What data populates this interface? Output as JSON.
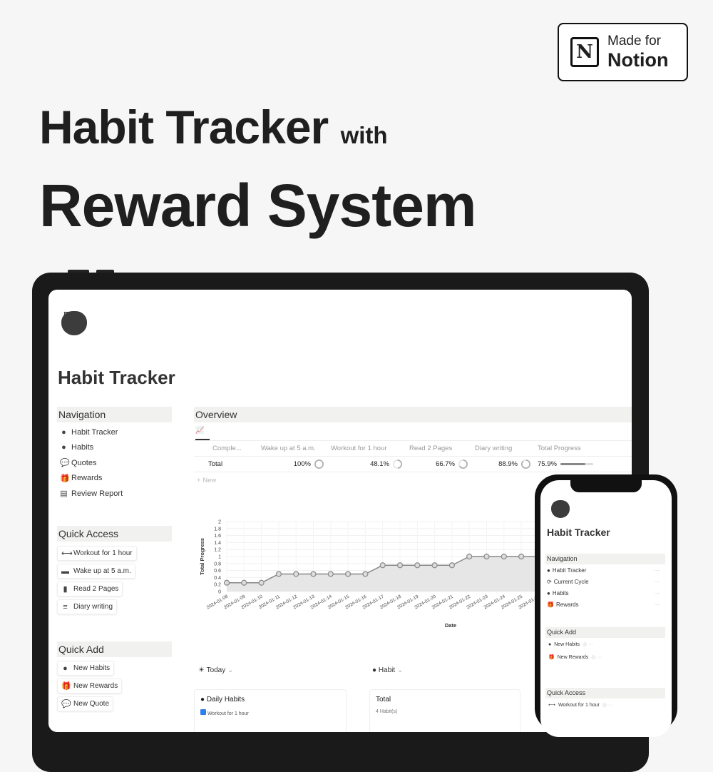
{
  "badge": {
    "line1": "Made for",
    "line2": "Notion",
    "logo": "N"
  },
  "headline": {
    "line1": "Habit Tracker",
    "with": "with",
    "line2": "Reward System"
  },
  "page": {
    "icon": "apple-icon",
    "title": "Habit Tracker"
  },
  "navigation": {
    "heading": "Navigation",
    "items": [
      {
        "label": "Habit Tracker",
        "icon": "apple-icon"
      },
      {
        "label": "Habits",
        "icon": "apple-icon"
      },
      {
        "label": "Quotes",
        "icon": "speech-bubble-icon"
      },
      {
        "label": "Rewards",
        "icon": "gift-icon"
      },
      {
        "label": "Review Report",
        "icon": "report-icon"
      }
    ]
  },
  "quick_access": {
    "heading": "Quick Access",
    "items": [
      {
        "label": "Workout for 1 hour",
        "icon": "dumbbell-icon"
      },
      {
        "label": "Wake up at 5 a.m.",
        "icon": "bed-icon"
      },
      {
        "label": "Read 2 Pages",
        "icon": "book-icon"
      },
      {
        "label": "Diary writing",
        "icon": "pen-icon"
      }
    ]
  },
  "quick_add": {
    "heading": "Quick Add",
    "items": [
      {
        "label": "New Habits",
        "icon": "apple-icon"
      },
      {
        "label": "New Rewards",
        "icon": "gift-icon"
      },
      {
        "label": "New Quote",
        "icon": "speech-bubble-icon"
      }
    ]
  },
  "overview": {
    "heading": "Overview",
    "columns": [
      "Comple...",
      "Wake up at 5 a.m.",
      "Workout for 1 hour",
      "Read 2 Pages",
      "Diary writing",
      "Total Progress"
    ],
    "row": {
      "label": "Total",
      "values": [
        "100%",
        "48.1%",
        "66.7%",
        "88.9%",
        "75.9%"
      ],
      "fractions": [
        1,
        0.481,
        0.667,
        0.889,
        0.759
      ]
    },
    "new_label": "New"
  },
  "chart_data": {
    "type": "area",
    "xlabel": "Date",
    "ylabel": "Total Progress",
    "ylim": [
      0,
      2
    ],
    "yticks": [
      "0",
      "0.2",
      "0.4",
      "0.6",
      "0.8",
      "1",
      "1.2",
      "1.4",
      "1.6",
      "1.8",
      "2"
    ],
    "x": [
      "2024-01-08",
      "2024-01-09",
      "2024-01-10",
      "2024-01-11",
      "2024-01-12",
      "2024-01-13",
      "2024-01-14",
      "2024-01-15",
      "2024-01-16",
      "2024-01-17",
      "2024-01-18",
      "2024-01-19",
      "2024-01-20",
      "2024-01-21",
      "2024-01-22",
      "2024-01-23",
      "2024-01-24",
      "2024-01-25",
      "2024-01-26"
    ],
    "values": [
      0.25,
      0.25,
      0.25,
      0.5,
      0.5,
      0.5,
      0.5,
      0.5,
      0.5,
      0.75,
      0.75,
      0.75,
      0.75,
      0.75,
      1,
      1,
      1,
      1,
      1
    ],
    "grid": true,
    "color": "#888888",
    "fill": "#e6e6e6"
  },
  "today": {
    "label": "Today",
    "card_title": "Daily Habits",
    "item": "Workout for 1 hour"
  },
  "habit": {
    "label": "Habit",
    "card_title": "Total",
    "count": "4 Habit(s)"
  },
  "phone": {
    "title": "Habit Tracker",
    "nav_heading": "Navigation",
    "nav": [
      "Habit Tracker",
      "Current Cycle",
      "Habits",
      "Rewards"
    ],
    "quick_add_heading": "Quick Add",
    "quick_add": [
      "New Habits",
      "New Rewards"
    ],
    "quick_access_heading": "Quick Access",
    "quick_access": [
      "Workout for 1 hour"
    ]
  }
}
